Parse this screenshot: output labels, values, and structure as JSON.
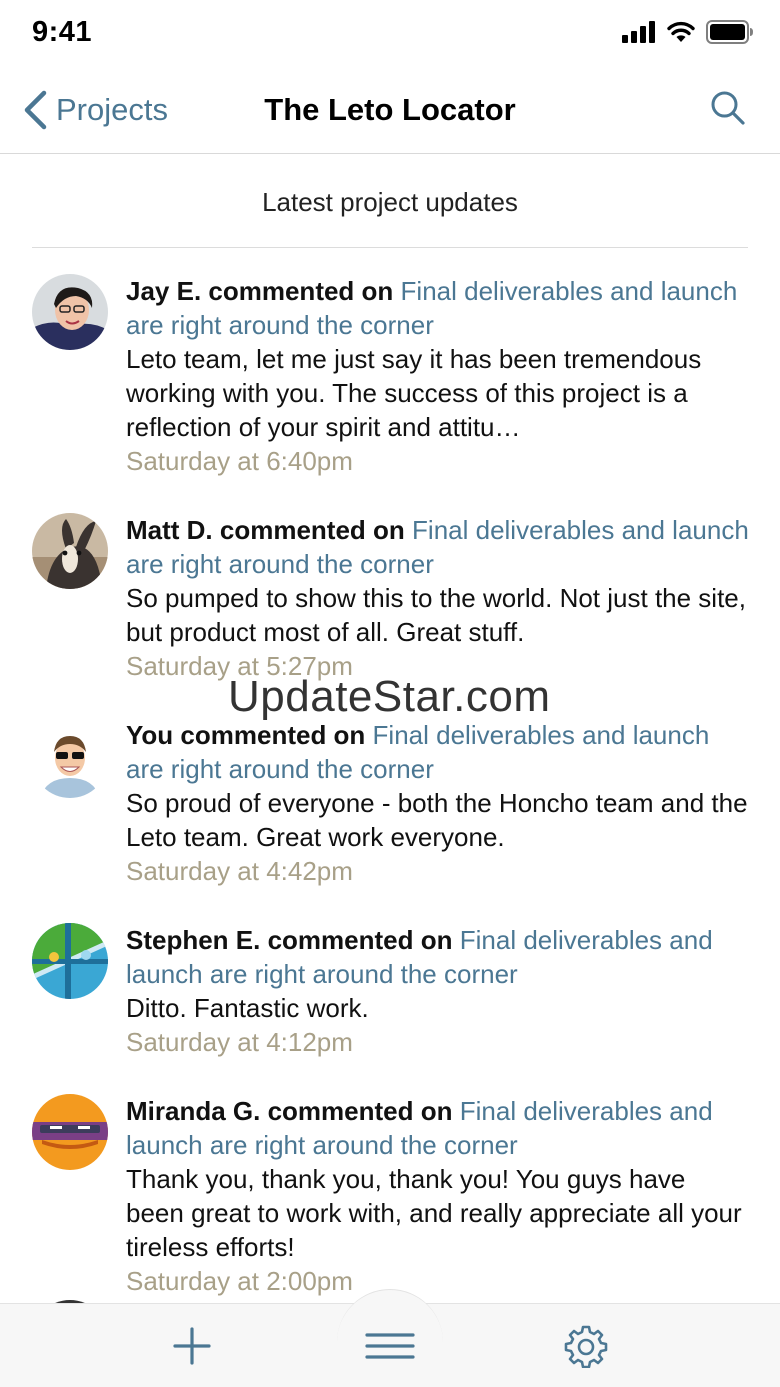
{
  "status_bar": {
    "time": "9:41"
  },
  "nav": {
    "back_label": "Projects",
    "title": "The Leto Locator"
  },
  "section_header": "Latest project updates",
  "link_text": "Final deliverables and launch are right around the corner",
  "feed": [
    {
      "author": "Jay E. commented on",
      "comment": "Leto team, let me just say it has been tremendous working with you. The success of this project is a reflection of your spirit and attitu…",
      "timestamp": "Saturday at 6:40pm"
    },
    {
      "author": "Matt D. commented on",
      "comment": "So pumped to show this to the world. Not just the site, but product most of all. Great stuff.",
      "timestamp": "Saturday at 5:27pm"
    },
    {
      "author": "You commented on",
      "comment": "So proud of everyone - both the Honcho team and the Leto team. Great work everyone.",
      "timestamp": "Saturday at 4:42pm"
    },
    {
      "author": "Stephen E. commented on",
      "comment": "Ditto. Fantastic work.",
      "timestamp": "Saturday at 4:12pm"
    },
    {
      "author": "Miranda G. commented on",
      "comment": "Thank you, thank you, thank you! You guys have been great to work with, and really appreciate all your tireless efforts!",
      "timestamp": "Saturday at 2:00pm"
    }
  ],
  "watermark": "UpdateStar.com",
  "colors": {
    "accent": "#4b7793",
    "timestamp": "#a8a088",
    "tab_icon": "#4b7793"
  },
  "tab_bar": {
    "icons": [
      "plus-icon",
      "menu-icon",
      "gear-icon"
    ]
  }
}
